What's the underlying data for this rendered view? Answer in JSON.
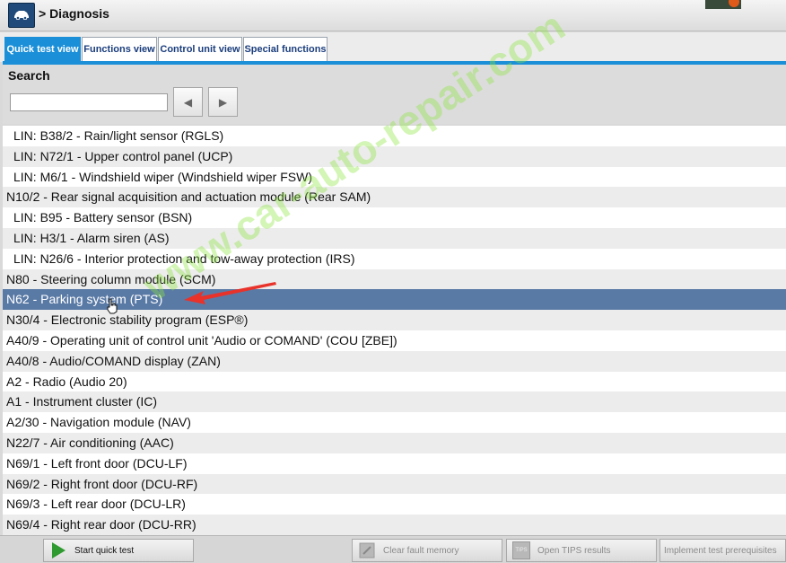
{
  "header": {
    "breadcrumb": "> Diagnosis"
  },
  "tabs": [
    {
      "label": "Quick test view",
      "active": true
    },
    {
      "label": "Functions view",
      "active": false
    },
    {
      "label": "Control unit view",
      "active": false
    },
    {
      "label": "Special functions",
      "active": false
    }
  ],
  "search": {
    "label": "Search",
    "value": "",
    "prev_glyph": "◀",
    "next_glyph": "▶"
  },
  "list": {
    "selected_index": 8,
    "items": [
      {
        "label": "LIN: B38/2 - Rain/light sensor (RGLS)",
        "indent": true
      },
      {
        "label": "LIN: N72/1 - Upper control panel (UCP)",
        "indent": true
      },
      {
        "label": "LIN: M6/1 - Windshield wiper (Windshield wiper FSW)",
        "indent": true
      },
      {
        "label": "N10/2 - Rear signal acquisition and actuation module (Rear SAM)",
        "indent": false
      },
      {
        "label": "LIN: B95 - Battery sensor (BSN)",
        "indent": true
      },
      {
        "label": "LIN: H3/1 - Alarm siren (AS)",
        "indent": true
      },
      {
        "label": "LIN: N26/6 - Interior protection and tow-away protection (IRS)",
        "indent": true
      },
      {
        "label": "N80 - Steering column module (SCM)",
        "indent": false
      },
      {
        "label": "N62 - Parking system (PTS)",
        "indent": false
      },
      {
        "label": "N30/4 - Electronic stability program (ESP®)",
        "indent": false
      },
      {
        "label": "A40/9 - Operating unit of control unit 'Audio or COMAND' (COU [ZBE])",
        "indent": false
      },
      {
        "label": "A40/8 - Audio/COMAND display (ZAN)",
        "indent": false
      },
      {
        "label": "A2 - Radio (Audio 20)",
        "indent": false
      },
      {
        "label": "A1 - Instrument cluster (IC)",
        "indent": false
      },
      {
        "label": "A2/30 - Navigation module (NAV)",
        "indent": false
      },
      {
        "label": "N22/7 - Air conditioning (AAC)",
        "indent": false
      },
      {
        "label": "N69/1 - Left front door (DCU-LF)",
        "indent": false
      },
      {
        "label": "N69/2 - Right front door (DCU-RF)",
        "indent": false
      },
      {
        "label": "N69/3 - Left rear door (DCU-LR)",
        "indent": false
      },
      {
        "label": "N69/4 - Right rear door (DCU-RR)",
        "indent": false
      }
    ]
  },
  "footer": {
    "start_quick_test": "Start quick test",
    "clear_fault_memory": "Clear fault memory",
    "tips_badge": "TIPS",
    "open_tips": "Open TIPS results",
    "implement_prereq": "Implement test prerequisites"
  },
  "watermark": "www.car-auto-repair.com",
  "colors": {
    "accent": "#1b8fd8",
    "selected_row": "#5a7aa6",
    "play_green": "#2f9a2f",
    "annotation_arrow": "#e8322a"
  }
}
